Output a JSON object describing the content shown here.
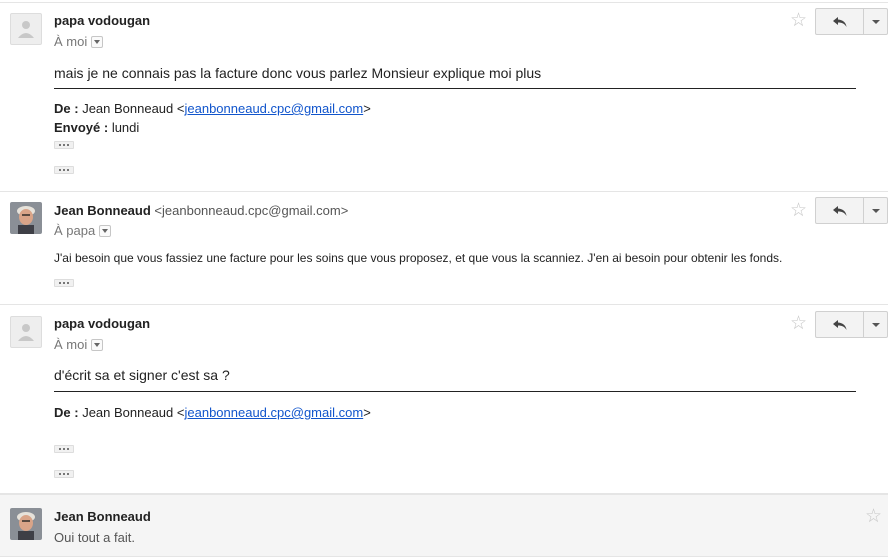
{
  "messages": [
    {
      "sender": "papa vodougan",
      "to": "À moi",
      "body": "mais je ne connais pas la facture donc vous parlez Monsieur explique moi plus",
      "from_label": "De :",
      "from_name": "Jean Bonneaud <",
      "from_email": "jeanbonneaud.cpc@gmail.com",
      "from_close": ">",
      "sent_label": "Envoyé :",
      "sent_value": "lundi"
    },
    {
      "sender": "Jean Bonneaud",
      "sender_email": "<jeanbonneaud.cpc@gmail.com>",
      "to": "À papa",
      "body": "J'ai besoin que vous fassiez une facture pour les soins que vous proposez, et que vous la scanniez. J'en ai besoin pour obtenir les fonds."
    },
    {
      "sender": "papa vodougan",
      "to": "À moi",
      "body": "d'écrit sa et signer c'est sa ?",
      "from_label": "De :",
      "from_name": "Jean Bonneaud <",
      "from_email": "jeanbonneaud.cpc@gmail.com",
      "from_close": ">"
    },
    {
      "sender": "Jean Bonneaud",
      "snippet": "Oui tout a fait."
    }
  ],
  "icons": {
    "star": "star-icon",
    "reply": "reply-icon",
    "more": "more-options-icon",
    "avatar_generic": "generic-avatar",
    "avatar_photo": "profile-photo"
  },
  "colors": {
    "link": "#1155cc",
    "collapsed_bg": "#f5f5f5"
  }
}
